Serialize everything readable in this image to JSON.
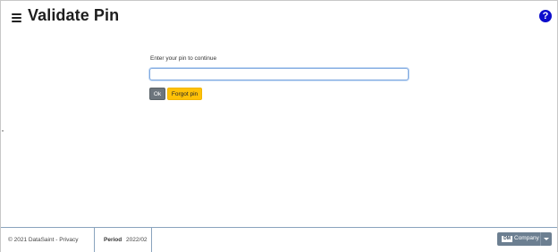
{
  "header": {
    "title": "Validate Pin",
    "help_symbol": "?"
  },
  "form": {
    "prompt": "Enter your pin to continue",
    "pin_value": "",
    "ok_label": "Ok",
    "forgot_label": "Forgot pin"
  },
  "footer": {
    "copyright": "© 2021 DataSaint -",
    "privacy_link": "Privacy",
    "period_label": "Period",
    "period_value": "2022/02",
    "company_badge": "DM",
    "company_label": "Company"
  },
  "icons": [
    "hamburger-menu-icon",
    "help-icon",
    "chevron-down-icon"
  ],
  "colors": {
    "help_icon": "#0d0dcc",
    "ok_button": "#6c757d",
    "forgot_button": "#ffc107",
    "company_button": "#6c7f91",
    "input_focus_border": "#80a9e0"
  }
}
